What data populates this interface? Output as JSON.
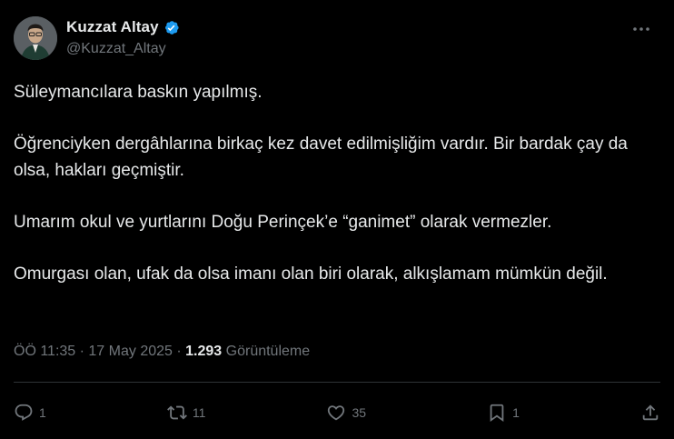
{
  "author": {
    "display_name": "Kuzzat Altay",
    "handle": "@Kuzzat_Altay",
    "verified_color": "#1d9bf0"
  },
  "tweet": {
    "paragraphs": [
      "Süleymancılara baskın yapılmış.",
      "Öğrenciyken dergâhlarına birkaç kez davet edilmişliğim vardır. Bir bardak çay da olsa, hakları geçmiştir.",
      "Umarım okul ve yurtlarını Doğu Perinçek’e “ganimet” olarak vermezler.",
      "Omurgası olan, ufak da olsa imanı olan biri olarak, alkışlamam mümkün değil."
    ]
  },
  "meta": {
    "time": "ÖÖ 11:35",
    "separator": " · ",
    "date": "17 May 2025",
    "views_count": "1.293",
    "views_label": "Görüntüleme"
  },
  "actions": {
    "replies": "1",
    "retweets": "11",
    "likes": "35",
    "bookmarks": "1"
  },
  "colors": {
    "background": "#000000",
    "text": "#e7e9ea",
    "secondary": "#71767b",
    "accent": "#1d9bf0",
    "divider": "#2f3336"
  }
}
